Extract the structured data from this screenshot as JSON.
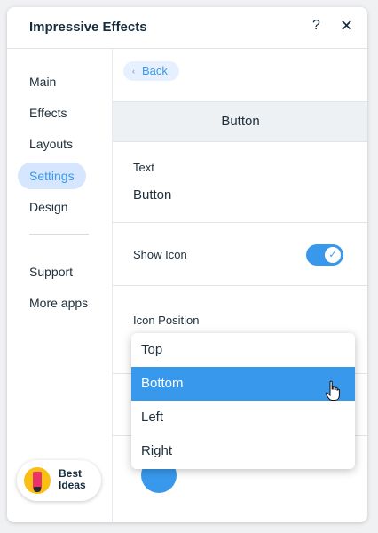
{
  "header": {
    "title": "Impressive Effects",
    "help_label": "?",
    "close_label": "✕"
  },
  "sidebar": {
    "items": [
      {
        "label": "Main",
        "active": false
      },
      {
        "label": "Effects",
        "active": false
      },
      {
        "label": "Layouts",
        "active": false
      },
      {
        "label": "Settings",
        "active": true
      },
      {
        "label": "Design",
        "active": false
      }
    ],
    "secondary": [
      {
        "label": "Support"
      },
      {
        "label": "More apps"
      }
    ],
    "best_ideas": {
      "line1": "Best",
      "line2": "Ideas"
    }
  },
  "content": {
    "back_label": "Back",
    "section_title": "Button",
    "text_field": {
      "label": "Text",
      "value": "Button"
    },
    "show_icon": {
      "label": "Show Icon",
      "enabled": true
    },
    "icon_position": {
      "label": "Icon Position",
      "selected": "Bottom"
    }
  },
  "dropdown": {
    "options": [
      "Top",
      "Bottom",
      "Left",
      "Right"
    ]
  },
  "colors": {
    "accent": "#3899ec",
    "active_nav_bg": "#d6e6fe",
    "section_bg": "#eef1f4"
  }
}
